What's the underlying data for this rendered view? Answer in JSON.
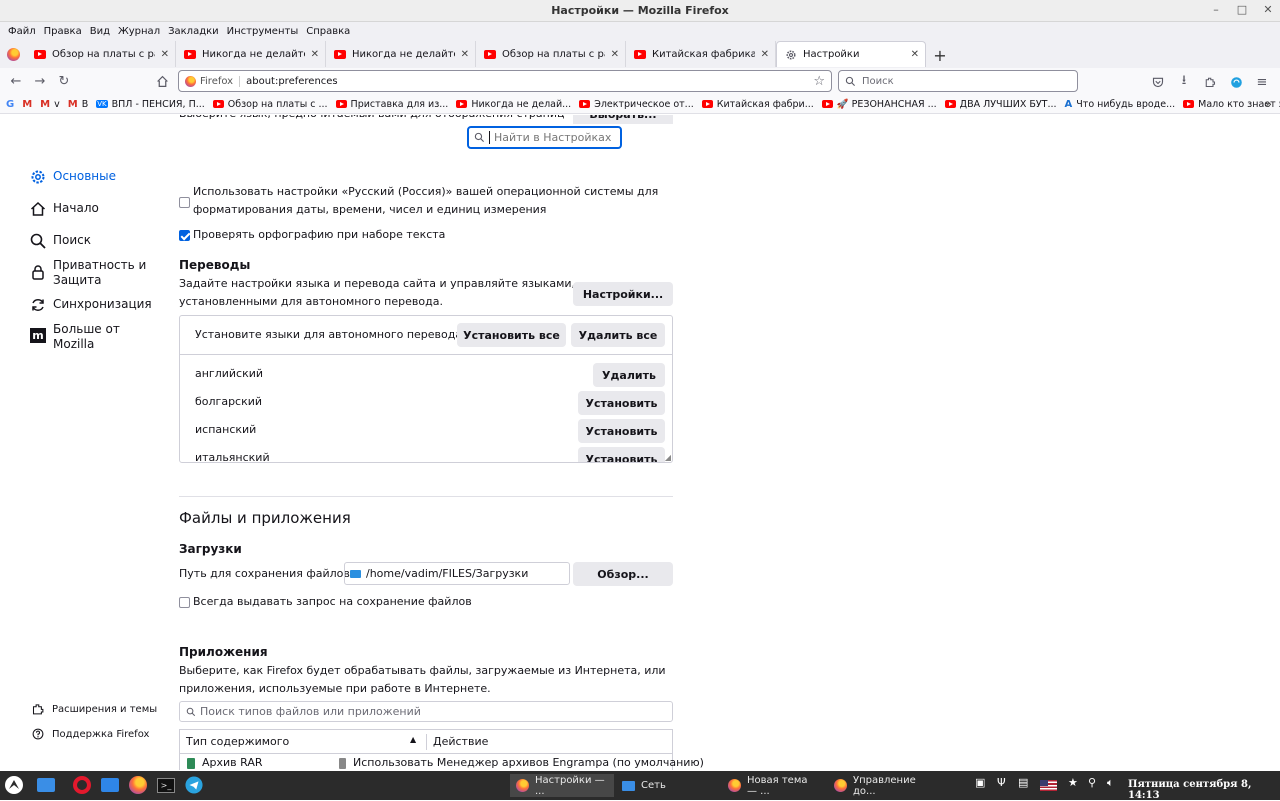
{
  "window": {
    "title": "Настройки — Mozilla Firefox"
  },
  "menubar": [
    "Файл",
    "Правка",
    "Вид",
    "Журнал",
    "Закладки",
    "Инструменты",
    "Справка"
  ],
  "tabs": [
    {
      "label": "Обзор на платы с ракеты",
      "icon": "youtube-icon"
    },
    {
      "label": "Никогда не делайте такое",
      "icon": "youtube-icon"
    },
    {
      "label": "Никогда не делайте такое",
      "icon": "youtube-icon"
    },
    {
      "label": "Обзор на платы с ракеты",
      "icon": "youtube-icon"
    },
    {
      "label": "Китайская фабрика по пр",
      "icon": "youtube-icon"
    },
    {
      "label": "Настройки",
      "icon": "gear-icon",
      "active": true
    }
  ],
  "navbar": {
    "identity": "Firefox",
    "url": "about:preferences",
    "search_placeholder": "Поиск"
  },
  "bookmarks": [
    {
      "label": "",
      "icon": "google-icon"
    },
    {
      "label": "",
      "icon": "gmail-icon"
    },
    {
      "label": "v",
      "icon": "gmail-icon"
    },
    {
      "label": "B",
      "icon": "gmail-icon"
    },
    {
      "label": "ВПЛ - ПЕНСИЯ, П...",
      "icon": "vk-icon"
    },
    {
      "label": "Обзор на платы с ...",
      "icon": "youtube-icon"
    },
    {
      "label": "Приставка для из...",
      "icon": "youtube-icon"
    },
    {
      "label": "Никогда не делай...",
      "icon": "youtube-icon"
    },
    {
      "label": "Электрическое от...",
      "icon": "youtube-icon"
    },
    {
      "label": "Китайская фабри...",
      "icon": "youtube-icon"
    },
    {
      "label": "🚀 РЕЗОНАНСНАЯ ...",
      "icon": "youtube-icon"
    },
    {
      "label": "ДВА ЛУЧШИХ БУТ...",
      "icon": "youtube-icon"
    },
    {
      "label": "Что нибудь вроде...",
      "icon": "a-icon"
    },
    {
      "label": "Мало кто знает эт...",
      "icon": "youtube-icon"
    }
  ],
  "find": {
    "placeholder": "Найти в Настройках"
  },
  "sidebar": {
    "items": [
      {
        "label": "Основные",
        "icon": "gear-icon",
        "active": true
      },
      {
        "label": "Начало",
        "icon": "home-icon"
      },
      {
        "label": "Поиск",
        "icon": "search-icon"
      },
      {
        "label": "Приватность и\nЗащита",
        "icon": "lock-icon"
      },
      {
        "label": "Синхронизация",
        "icon": "sync-icon"
      },
      {
        "label": "Больше от\nMozilla",
        "icon": "mozilla-icon"
      }
    ],
    "footer": [
      {
        "label": "Расширения и темы",
        "icon": "puzzle-icon"
      },
      {
        "label": "Поддержка Firefox",
        "icon": "help-icon"
      }
    ]
  },
  "language": {
    "cut_text": "Выберите язык, предпочитаемый вами для отображения страниц",
    "cut_button": "Выбрать...",
    "os_locale_line1": "Использовать настройки «Русский (Россия)» вашей операционной системы для",
    "os_locale_line2": "форматирования даты, времени, чисел и единиц измерения",
    "spellcheck": "Проверять орфографию при наборе текста"
  },
  "translations": {
    "title": "Переводы",
    "desc_line1": "Задайте настройки языка и перевода сайта и управляйте языками,",
    "desc_line2": "установленными для автономного перевода.",
    "settings_button": "Настройки...",
    "box_title": "Установите языки для автономного перевода",
    "install_all": "Установить все",
    "remove_all": "Удалить все",
    "languages": [
      {
        "name": "английский",
        "action": "Удалить"
      },
      {
        "name": "болгарский",
        "action": "Установить"
      },
      {
        "name": "испанский",
        "action": "Установить"
      },
      {
        "name": "итальянский",
        "action": "Установить"
      }
    ]
  },
  "files": {
    "section_title": "Файлы и приложения",
    "downloads_title": "Загрузки",
    "save_path_label": "Путь для сохранения файлов",
    "save_path": "/home/vadim/FILES/Загрузки",
    "browse_button": "Обзор...",
    "always_ask": "Всегда выдавать запрос на сохранение файлов",
    "apps_title": "Приложения",
    "apps_desc_line1": "Выберите, как Firefox будет обрабатывать файлы, загружаемые из Интернета, или",
    "apps_desc_line2": "приложения, используемые при работе в Интернете.",
    "apps_search_placeholder": "Поиск типов файлов или приложений",
    "col_type": "Тип содержимого",
    "col_action": "Действие",
    "rows": [
      {
        "type": "Архив RAR",
        "action": "Использовать Менеджер архивов Engrampa (по умолчанию)"
      }
    ]
  },
  "taskbar": {
    "windows": [
      {
        "label": "Настройки — ...",
        "icon": "firefox-icon",
        "active": true
      },
      {
        "label": "Сеть",
        "icon": "network-icon"
      },
      {
        "label": "Новая тема — ...",
        "icon": "firefox-icon"
      },
      {
        "label": "Управление до...",
        "icon": "firefox-icon"
      }
    ],
    "clock": "Пятница сентября  8, 14:13"
  },
  "colors": {
    "accent": "#0061e0",
    "youtube": "#ff0000",
    "taskbar": "#2b2b2b"
  }
}
